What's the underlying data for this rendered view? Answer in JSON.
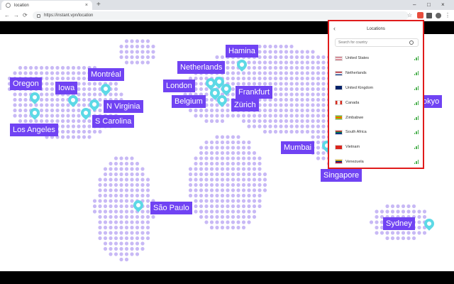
{
  "browser": {
    "tab_title": "location",
    "tab_close": "×",
    "new_tab": "+",
    "url": "https://instant.vpn/location",
    "nav": {
      "back": "←",
      "forward": "→",
      "reload": "⟳"
    },
    "window_controls": {
      "minimize": "–",
      "maximize": "□",
      "close": "×"
    },
    "star": "☆",
    "menu": "⋮"
  },
  "map": {
    "dot_color": "#c8b9f5",
    "label_color": "#7043f3",
    "pin_color": "#5dd9e6",
    "locations": [
      {
        "name": "Hamina"
      },
      {
        "name": "Oregon"
      },
      {
        "name": "Iowa"
      },
      {
        "name": "Montréal"
      },
      {
        "name": "Netherlands"
      },
      {
        "name": "London"
      },
      {
        "name": "Frankfurt"
      },
      {
        "name": "Belgium"
      },
      {
        "name": "Zürich"
      },
      {
        "name": "N Virginia"
      },
      {
        "name": "S Carolina"
      },
      {
        "name": "Los Angeles"
      },
      {
        "name": "Mumbai"
      },
      {
        "name": "Singapore"
      },
      {
        "name": "okyo"
      },
      {
        "name": "São Paulo"
      },
      {
        "name": "Sydney"
      }
    ]
  },
  "popup": {
    "title": "Locations",
    "back_icon": "‹",
    "search_placeholder": "Search for country",
    "highlight_color": "#e01b1b",
    "countries": [
      {
        "name": "United States",
        "flag": "us-flag"
      },
      {
        "name": "Netherlands",
        "flag": "nl-flag"
      },
      {
        "name": "United Kingdom",
        "flag": "uk-flag"
      },
      {
        "name": "Canada",
        "flag": "ca-flag"
      },
      {
        "name": "Zimbabwe",
        "flag": "zw-flag"
      },
      {
        "name": "South Africa",
        "flag": "za-flag"
      },
      {
        "name": "Vietnam",
        "flag": "vn-flag"
      },
      {
        "name": "Venezuela",
        "flag": "ve-flag"
      }
    ]
  }
}
